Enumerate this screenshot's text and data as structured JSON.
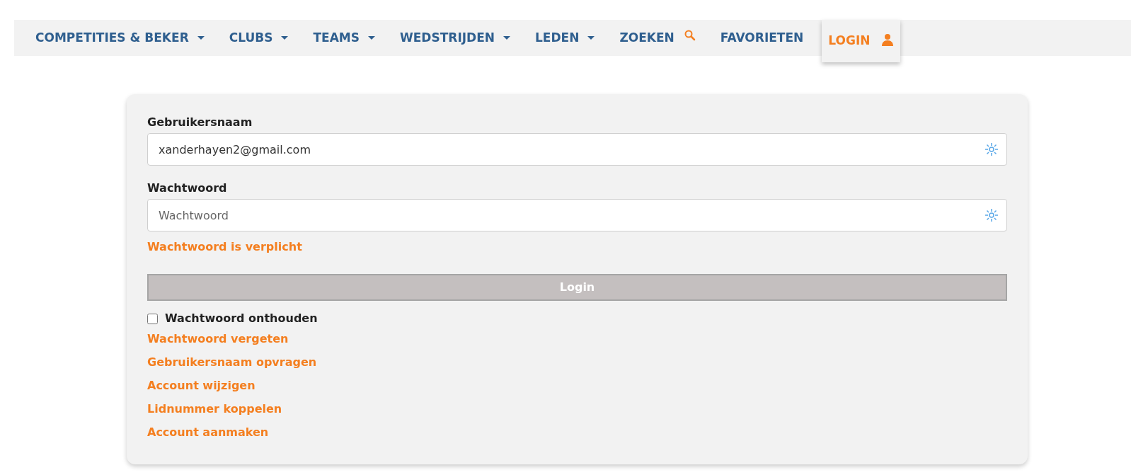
{
  "nav": {
    "items": [
      {
        "label": "COMPETITIES & BEKER",
        "kind": "dropdown",
        "selected": false
      },
      {
        "label": "CLUBS",
        "kind": "dropdown",
        "selected": false
      },
      {
        "label": "TEAMS",
        "kind": "dropdown",
        "selected": false
      },
      {
        "label": "WEDSTRIJDEN",
        "kind": "dropdown",
        "selected": false
      },
      {
        "label": "LEDEN",
        "kind": "dropdown",
        "selected": false
      },
      {
        "label": "ZOEKEN",
        "kind": "search",
        "selected": false
      },
      {
        "label": "FAVORIETEN",
        "kind": "plain",
        "selected": false
      },
      {
        "label": "LOGIN",
        "kind": "user",
        "selected": true
      }
    ]
  },
  "form": {
    "username": {
      "label": "Gebruikersnaam",
      "value": "xanderhayen2@gmail.com"
    },
    "password": {
      "label": "Wachtwoord",
      "placeholder": "Wachtwoord",
      "error": "Wachtwoord is verplicht"
    },
    "submit": {
      "label": "Login",
      "disabled": true
    },
    "remember": {
      "label": "Wachtwoord onthouden",
      "checked": false
    },
    "links": [
      "Wachtwoord vergeten",
      "Gebruikersnaam opvragen",
      "Account wijzigen",
      "Lidnummer koppelen",
      "Account aanmaken"
    ]
  }
}
